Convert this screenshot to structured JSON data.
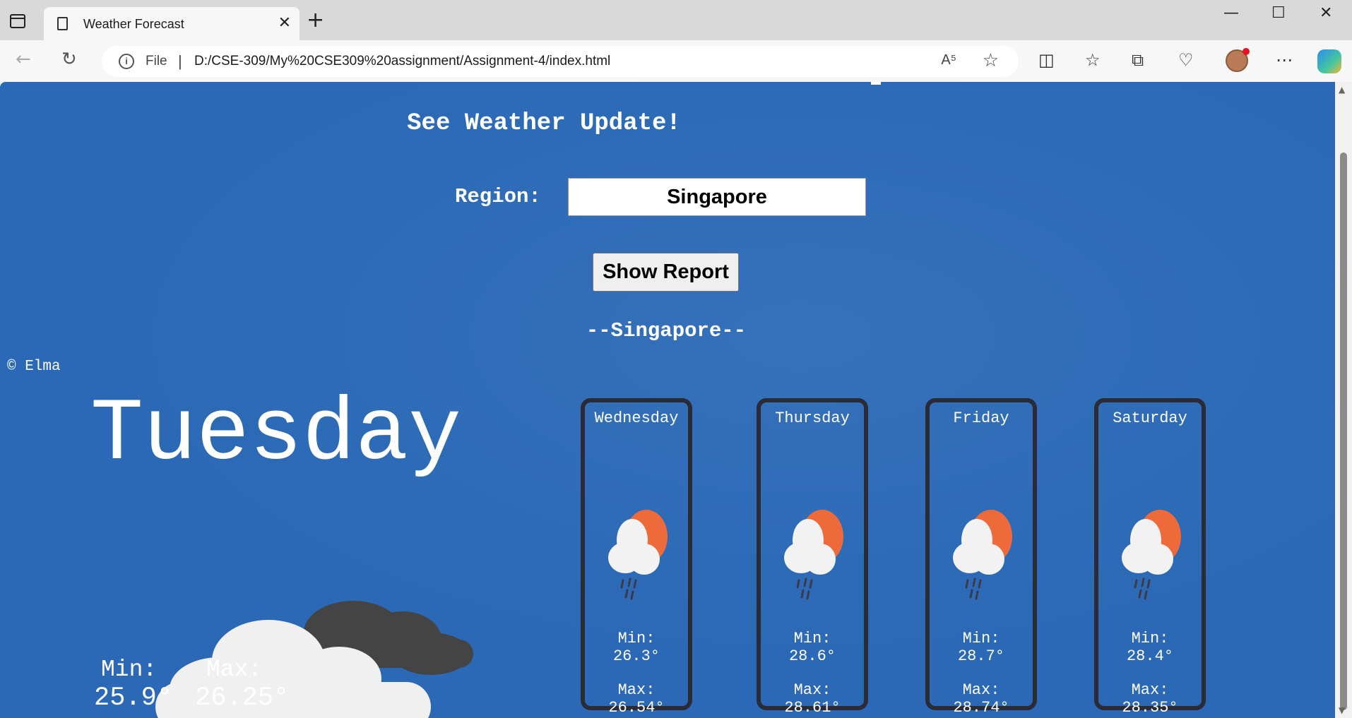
{
  "browser": {
    "tab_title": "Weather Forecast",
    "tab_close": "✕",
    "new_tab": "+",
    "window_controls": [
      "—",
      "☐",
      "✕"
    ],
    "url_scheme_label": "File",
    "url_separator": "|",
    "url": "D:/CSE-309/My%20CSE309%20assignment/Assignment-4/index.html",
    "read_aloud_icon": "A⁵",
    "icons": [
      "sidebar-icon",
      "page-icon",
      "back-icon",
      "refresh-icon",
      "info-icon",
      "read-aloud-icon",
      "favorite-star-icon",
      "split-screen-icon",
      "favorites-icon",
      "collections-icon",
      "browser-essentials-icon",
      "profile-avatar",
      "more-icon",
      "copilot-icon"
    ]
  },
  "page": {
    "heading": "See Weather Update!",
    "region_label": "Region:",
    "region_value": "Singapore",
    "show_button": "Show Report",
    "city_heading": "--Singapore--",
    "copyright": "© Elma",
    "today": {
      "day": "Tuesday",
      "icon": "cloudy-icon",
      "min_label": "Min:",
      "max_label": "Max:",
      "min": "25.9°",
      "max": "26.25°"
    },
    "forecast": [
      {
        "day": "Wednesday",
        "icon": "rain-sun-icon",
        "min_label": "Min:",
        "min": "26.3°",
        "max_label": "Max:",
        "max": "26.54°"
      },
      {
        "day": "Thursday",
        "icon": "rain-sun-icon",
        "min_label": "Min:",
        "min": "28.6°",
        "max_label": "Max:",
        "max": "28.61°"
      },
      {
        "day": "Friday",
        "icon": "rain-sun-icon",
        "min_label": "Min:",
        "min": "28.7°",
        "max_label": "Max:",
        "max": "28.74°"
      },
      {
        "day": "Saturday",
        "icon": "rain-sun-icon",
        "min_label": "Min:",
        "min": "28.4°",
        "max_label": "Max:",
        "max": "28.35°"
      }
    ]
  },
  "colors": {
    "page_background": "#2b69b6",
    "card_border": "#2b2b36",
    "text": "#ffffff",
    "sun": "#ef6a3a",
    "cloud_light": "#f0f0f0",
    "cloud_dark": "#444444"
  }
}
